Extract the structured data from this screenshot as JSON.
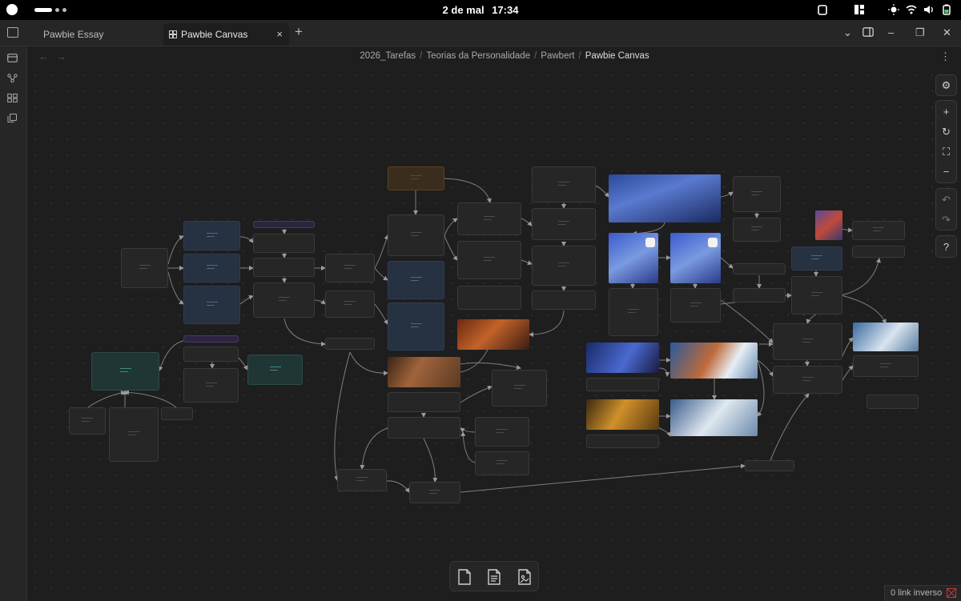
{
  "status_bar": {
    "date": "2 de mal",
    "time": "17:34"
  },
  "tabs": [
    {
      "label": "Pawbie Essay",
      "active": false
    },
    {
      "label": "Pawbie Canvas",
      "active": true
    }
  ],
  "tab_close": "×",
  "new_tab": "+",
  "window_controls": {
    "dropdown": "⌄",
    "minimize": "–",
    "maximize": "❐",
    "close": "✕"
  },
  "nav": {
    "back": "←",
    "forward": "→",
    "more": "⋮"
  },
  "breadcrumb": [
    "2026_Tarefas",
    "Teorias da Personalidade",
    "Pawbert",
    "Pawbie Canvas"
  ],
  "breadcrumb_sep": "/",
  "canvas_controls": {
    "settings": "⚙",
    "zoom_in": "+",
    "reset": "↻",
    "fit": "⛶",
    "zoom_out": "−",
    "undo": "↶",
    "redo": "↷",
    "help": "?"
  },
  "ribbon_icons": [
    "panel-icon",
    "graph-icon",
    "canvas-grid-icon",
    "copy-icon"
  ],
  "bottom_toolbar": [
    "new-card-icon",
    "note-file-icon",
    "media-file-icon"
  ],
  "status_footer": {
    "backlinks": "0 link inverso"
  },
  "colors": {
    "background": "#1e1e1e",
    "card": "#262626",
    "blue_card": "#263141",
    "teal_card": "#1f3634",
    "orange_card": "#3a2d1d",
    "purple_card": "#2d2540",
    "edge": "#8a8a8a"
  }
}
